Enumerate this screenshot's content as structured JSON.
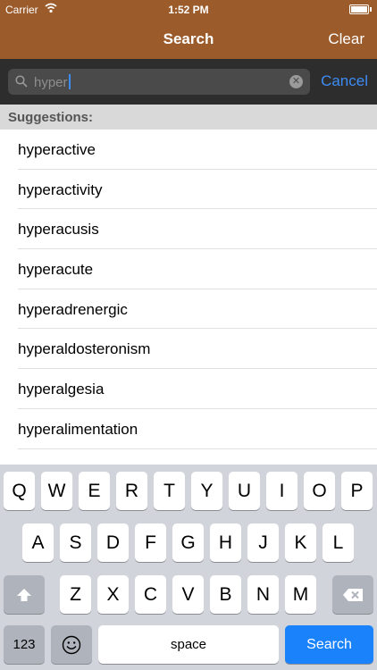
{
  "status": {
    "carrier": "Carrier",
    "time": "1:52 PM"
  },
  "nav": {
    "title": "Search",
    "clear": "Clear"
  },
  "search": {
    "value": "hyper",
    "cancel": "Cancel"
  },
  "suggestions": {
    "header": "Suggestions:",
    "items": [
      "hyperactive",
      "hyperactivity",
      "hyperacusis",
      "hyperacute",
      "hyperadrenergic",
      "hyperaldosteronism",
      "hyperalgesia",
      "hyperalimentation"
    ]
  },
  "keyboard": {
    "row1": [
      "Q",
      "W",
      "E",
      "R",
      "T",
      "Y",
      "U",
      "I",
      "O",
      "P"
    ],
    "row2": [
      "A",
      "S",
      "D",
      "F",
      "G",
      "H",
      "J",
      "K",
      "L"
    ],
    "row3": [
      "Z",
      "X",
      "C",
      "V",
      "B",
      "N",
      "M"
    ],
    "numbers": "123",
    "space": "space",
    "search": "Search"
  },
  "colors": {
    "nav_bar": "#9b5b2b",
    "accent": "#3d8cf5",
    "search_key": "#1a82fb"
  }
}
